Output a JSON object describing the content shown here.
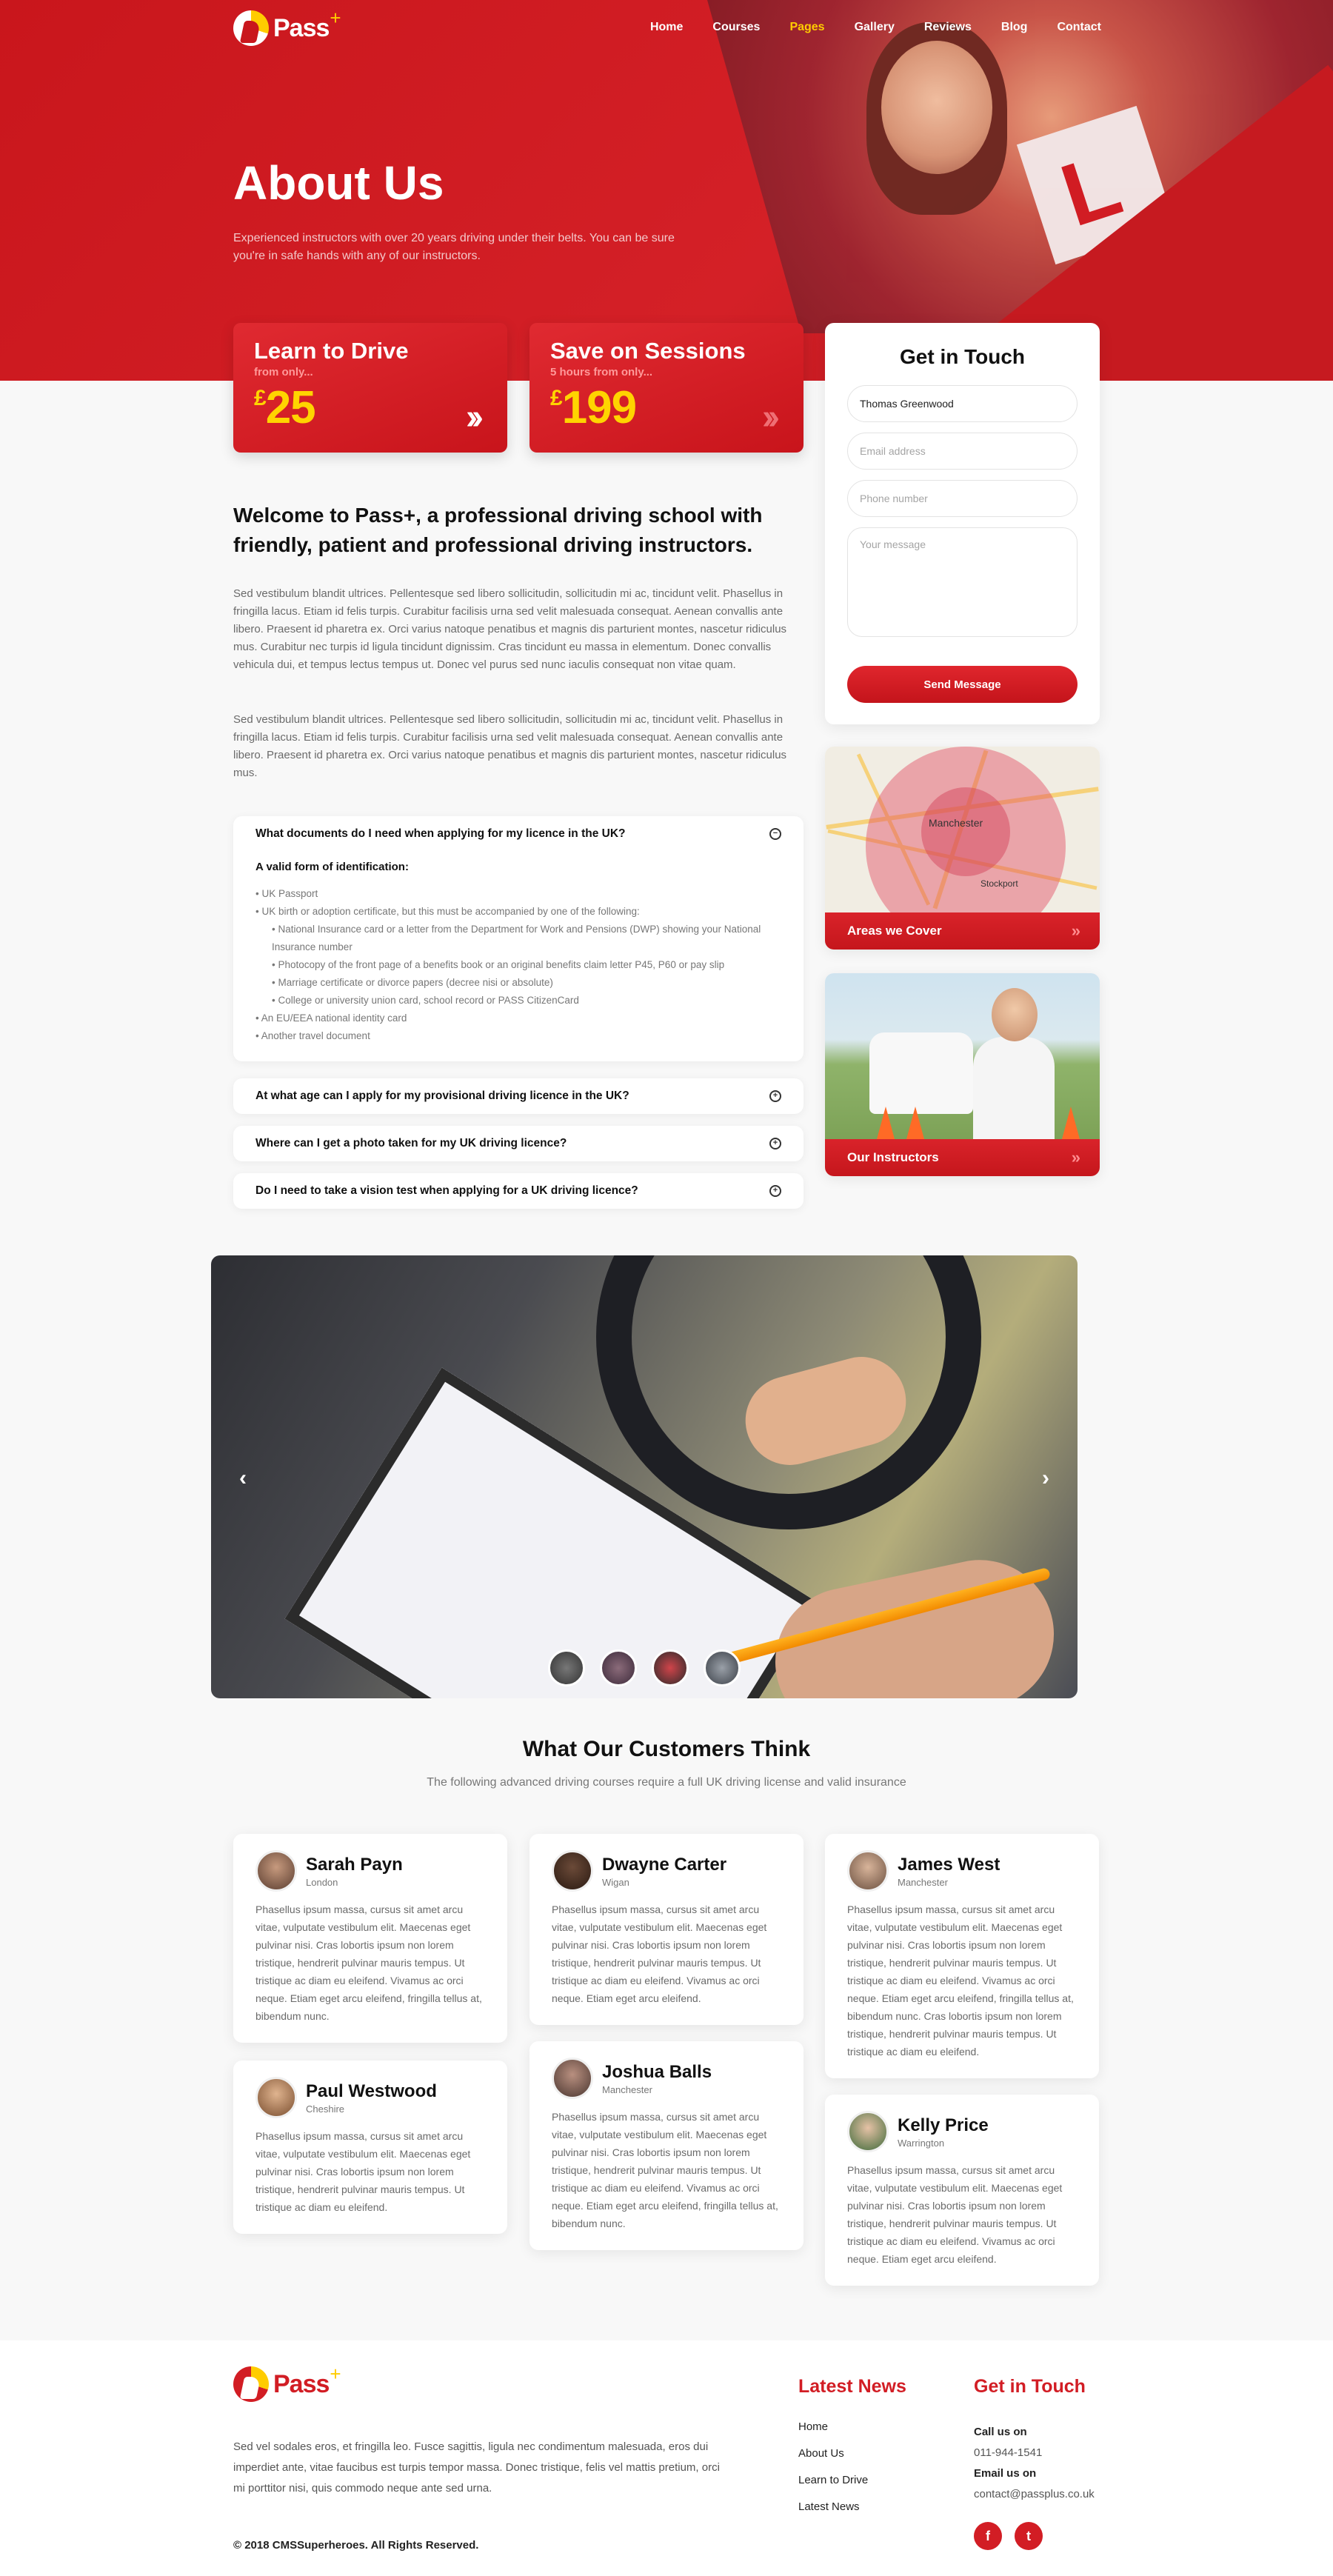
{
  "brand": {
    "name": "Pass",
    "plus": "+"
  },
  "nav": {
    "items": [
      "Home",
      "Courses",
      "Pages",
      "Gallery",
      "Reviews",
      "Blog",
      "Contact"
    ],
    "active": "Pages"
  },
  "hero": {
    "title": "About Us",
    "subtitle": "Experienced instructors with over 20 years driving under their belts. You can be sure you're in safe hands with any of our instructors."
  },
  "promos": [
    {
      "title": "Learn to Drive",
      "note": "from only...",
      "currency": "£",
      "price": "25"
    },
    {
      "title": "Save on Sessions",
      "note": "5 hours from only...",
      "currency": "£",
      "price": "199"
    }
  ],
  "contact_form": {
    "title": "Get in Touch",
    "name_value": "Thomas Greenwood",
    "email_placeholder": "Email address",
    "phone_placeholder": "Phone number",
    "message_placeholder": "Your message",
    "submit_label": "Send Message"
  },
  "side_cards": {
    "areas_label": "Areas we Cover",
    "instructors_label": "Our Instructors",
    "map_labels": {
      "city": "Manchester",
      "town": "Stockport"
    }
  },
  "welcome": {
    "heading": "Welcome to Pass+, a professional driving school with friendly, patient and professional driving instructors.",
    "para1": "Sed vestibulum blandit ultrices. Pellentesque sed libero sollicitudin, sollicitudin mi ac, tincidunt velit. Phasellus in fringilla lacus. Etiam id felis turpis. Curabitur facilisis urna sed velit malesuada consequat. Aenean convallis ante libero. Praesent id pharetra ex. Orci varius natoque penatibus et magnis dis parturient montes, nascetur ridiculus mus. Curabitur nec turpis id ligula tincidunt dignissim. Cras tincidunt eu massa in elementum. Donec convallis vehicula dui, et tempus lectus tempus ut. Donec vel purus sed nunc iaculis consequat non vitae quam.",
    "para2": "Sed vestibulum blandit ultrices. Pellentesque sed libero sollicitudin, sollicitudin mi ac, tincidunt velit. Phasellus in fringilla lacus. Etiam id felis turpis. Curabitur facilisis urna sed velit malesuada consequat. Aenean convallis ante libero. Praesent id pharetra ex. Orci varius natoque penatibus et magnis dis parturient montes, nascetur ridiculus mus."
  },
  "faq": [
    {
      "question": "What documents do I need when applying for my licence in the UK?",
      "expanded": true,
      "answer_title": "A valid form of identification:",
      "items": [
        {
          "text": "UK Passport",
          "sub": false
        },
        {
          "text": "UK birth or adoption certificate, but this must be accompanied by one of the following:",
          "sub": false
        },
        {
          "text": "National Insurance card or a letter from the Department for Work and Pensions (DWP) showing your National Insurance number",
          "sub": true
        },
        {
          "text": "Photocopy of the front page of a benefits book or an original benefits claim letter P45, P60 or pay slip",
          "sub": true
        },
        {
          "text": "Marriage certificate or divorce papers (decree nisi or absolute)",
          "sub": true
        },
        {
          "text": "College or university union card, school record or PASS CitizenCard",
          "sub": true
        },
        {
          "text": "An EU/EEA national identity card",
          "sub": false
        },
        {
          "text": "Another travel document",
          "sub": false
        }
      ]
    },
    {
      "question": "At what age can I apply for my provisional driving licence in the UK?",
      "expanded": false
    },
    {
      "question": "Where can I get a photo taken for my UK driving licence?",
      "expanded": false
    },
    {
      "question": "Do I need to take a vision test when applying for a UK driving licence?",
      "expanded": false
    }
  ],
  "testimonials": {
    "title": "What Our Customers Think",
    "subtitle": "The following advanced driving courses require a full UK driving license and valid insurance",
    "items": [
      {
        "name": "Sarah Payn",
        "location": "London",
        "text": "Phasellus ipsum massa, cursus sit amet arcu vitae, vulputate vestibulum elit. Maecenas eget pulvinar nisi. Cras lobortis ipsum non lorem tristique, hendrerit pulvinar mauris tempus. Ut tristique ac diam eu eleifend. Vivamus ac orci neque. Etiam eget arcu eleifend, fringilla tellus at, bibendum nunc."
      },
      {
        "name": "Dwayne Carter",
        "location": "Wigan",
        "text": "Phasellus ipsum massa, cursus sit amet arcu vitae, vulputate vestibulum elit. Maecenas eget pulvinar nisi. Cras lobortis ipsum non lorem tristique, hendrerit pulvinar mauris tempus. Ut tristique ac diam eu eleifend. Vivamus ac orci neque. Etiam eget arcu eleifend."
      },
      {
        "name": "James West",
        "location": "Manchester",
        "text": "Phasellus ipsum massa, cursus sit amet arcu vitae, vulputate vestibulum elit. Maecenas eget pulvinar nisi. Cras lobortis ipsum non lorem tristique, hendrerit pulvinar mauris tempus. Ut tristique ac diam eu eleifend. Vivamus ac orci neque. Etiam eget arcu eleifend, fringilla tellus at, bibendum nunc. Cras lobortis ipsum non lorem tristique, hendrerit pulvinar mauris tempus. Ut tristique ac diam eu eleifend."
      },
      {
        "name": "Paul Westwood",
        "location": "Cheshire",
        "text": "Phasellus ipsum massa, cursus sit amet arcu vitae, vulputate vestibulum elit. Maecenas eget pulvinar nisi. Cras lobortis ipsum non lorem tristique, hendrerit pulvinar mauris tempus. Ut tristique ac diam eu eleifend."
      },
      {
        "name": "Joshua Balls",
        "location": "Manchester",
        "text": "Phasellus ipsum massa, cursus sit amet arcu vitae, vulputate vestibulum elit. Maecenas eget pulvinar nisi. Cras lobortis ipsum non lorem tristique, hendrerit pulvinar mauris tempus. Ut tristique ac diam eu eleifend. Vivamus ac orci neque. Etiam eget arcu eleifend, fringilla tellus at, bibendum nunc."
      },
      {
        "name": "Kelly Price",
        "location": "Warrington",
        "text": "Phasellus ipsum massa, cursus sit amet arcu vitae, vulputate vestibulum elit. Maecenas eget pulvinar nisi. Cras lobortis ipsum non lorem tristique, hendrerit pulvinar mauris tempus. Ut tristique ac diam eu eleifend. Vivamus ac orci neque. Etiam eget arcu eleifend."
      }
    ]
  },
  "footer": {
    "about": "Sed vel sodales eros, et fringilla leo. Fusce sagittis, ligula nec condimentum malesuada, eros dui imperdiet ante, vitae faucibus est turpis tempor massa. Donec tristique, felis vel mattis pretium, orci mi porttitor nisi, quis commodo neque ante sed urna.",
    "copyright": "© 2018 CMSSuperheroes. All Rights Reserved.",
    "news_title": "Latest News",
    "news_links": [
      "Home",
      "About Us",
      "Learn to Drive",
      "Latest News"
    ],
    "contact_title": "Get in Touch",
    "call_label": "Call us on",
    "phone": "011-944-1541",
    "email_label": "Email us on",
    "email": "contact@passplus.co.uk",
    "social": {
      "facebook": "f",
      "twitter": "t"
    }
  },
  "colors": {
    "brand_red": "#d21d24",
    "accent_yellow": "#ffcc00"
  }
}
